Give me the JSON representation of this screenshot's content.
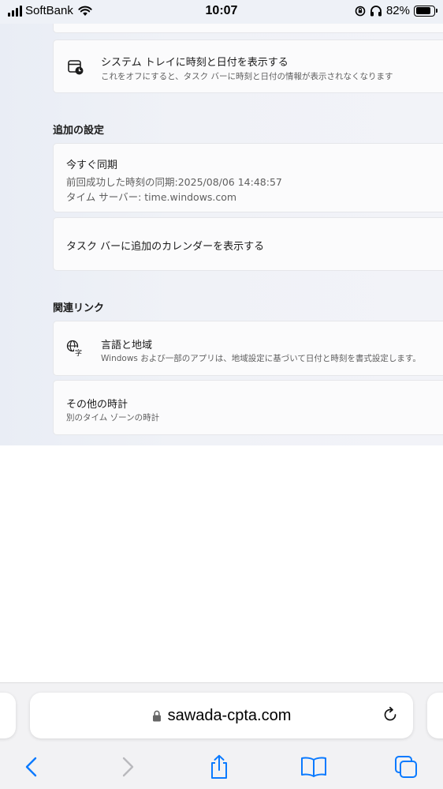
{
  "status_bar": {
    "carrier": "SoftBank",
    "time": "10:07",
    "battery": "82%",
    "battery_level": 0.82
  },
  "settings": {
    "tray_card": {
      "title": "システム トレイに時刻と日付を表示する",
      "desc": "これをオフにすると、タスク バーに時刻と日付の情報が表示されなくなります"
    },
    "additional": {
      "heading": "追加の設定",
      "sync": {
        "title": "今すぐ同期",
        "last_sync": "前回成功した時刻の同期:2025/08/06 14:48:57",
        "server": "タイム サーバー: time.windows.com"
      },
      "calendar": {
        "title": "タスク バーに追加のカレンダーを表示する"
      }
    },
    "related": {
      "heading": "関連リンク",
      "language": {
        "title": "言語と地域",
        "desc": "Windows および一部のアプリは、地域設定に基づいて日付と時刻を書式設定します。"
      },
      "clocks": {
        "title": "その他の時計",
        "desc": "別のタイム ゾーンの時計"
      }
    }
  },
  "browser": {
    "url": "sawada-cpta.com"
  },
  "icons": {
    "tray": "calendar-clock-icon",
    "language": "language-icon",
    "lock": "lock-icon",
    "reload": "reload-icon",
    "back": "back-icon",
    "forward": "forward-icon",
    "share": "share-icon",
    "bookmarks": "bookmarks-icon",
    "tabs": "tabs-icon"
  }
}
